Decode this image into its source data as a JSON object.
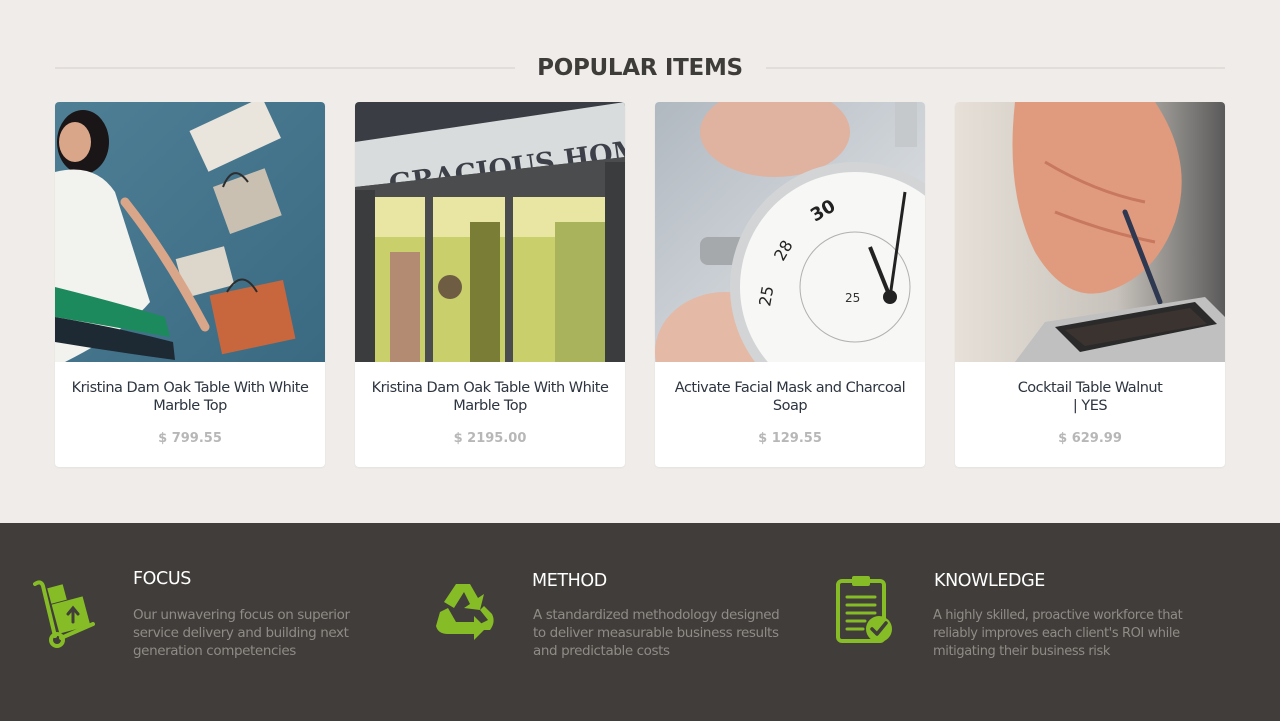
{
  "popular": {
    "heading": "POPULAR ITEMS",
    "items": [
      {
        "title": "Kristina Dam Oak Table With White\nMarble Top",
        "price": "$ 799.55",
        "image": "fashion-shopping-photo"
      },
      {
        "title": "Kristina Dam Oak Table With White\nMarble Top",
        "price": "$ 2195.00",
        "image": "gracious-home-storefront-photo",
        "sign": "GRACIOUS HOME"
      },
      {
        "title": "Activate Facial Mask and Charcoal\nSoap",
        "price": "$ 129.55",
        "image": "stopwatch-photo"
      },
      {
        "title": "Cocktail Table Walnut\n| YES",
        "price": "$ 629.99",
        "image": "stylus-tablet-photo"
      }
    ]
  },
  "features": [
    {
      "icon": "hand-truck-icon",
      "title": "FOCUS",
      "description": "Our unwavering focus on superior\nservice delivery and building next\ngeneration competencies"
    },
    {
      "icon": "recycle-icon",
      "title": "METHOD",
      "description": "A standardized methodology designed\nto deliver measurable business results\nand predictable costs"
    },
    {
      "icon": "clipboard-check-icon",
      "title": "KNOWLEDGE",
      "description": "A highly skilled, proactive workforce that\nreliably improves each client's ROI while\nmitigating their business risk"
    }
  ],
  "colors": {
    "accent": "#86bc25",
    "footer_bg": "#403d3a",
    "page_bg": "#f0ece9",
    "price": "#b7b7b7"
  }
}
